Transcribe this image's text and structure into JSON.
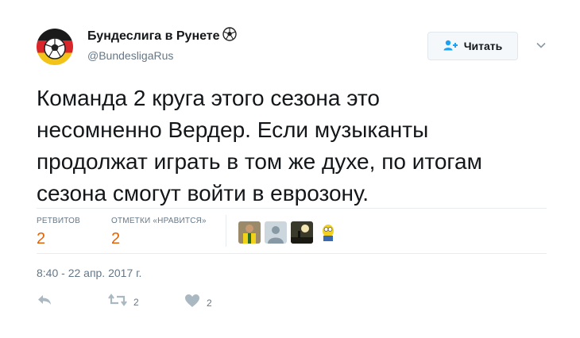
{
  "author": {
    "display_name": "Бундеслига в Рунете",
    "name_emoji": "soccer-ball-icon",
    "handle": "@BundesligaRus"
  },
  "follow_button": {
    "label": "Читать",
    "icon": "follow-person-plus-icon"
  },
  "tweet": {
    "text_lines": [
      "Команда 2 круга этого сезона это",
      "несомненно Вердер. Если музыканты",
      "продолжат играть в том же духе, по итогам",
      "сезона смогут войти в еврозону."
    ]
  },
  "stats": {
    "retweets_label": "РЕТВИТОВ",
    "retweets_value": "2",
    "likes_label": "ОТМЕТКИ «НРАВИТСЯ»",
    "likes_value": "2"
  },
  "timestamp": "8:40 - 22 апр. 2017 г.",
  "actions": {
    "reply_icon": "reply-icon",
    "retweet_icon": "retweet-icon",
    "retweet_count": "2",
    "like_icon": "heart-icon",
    "like_count": "2"
  },
  "colors": {
    "accent_orange": "#e0640a",
    "secondary_text": "#657786",
    "border": "#e6ecf0",
    "follow_icon": "#1da1f2"
  }
}
